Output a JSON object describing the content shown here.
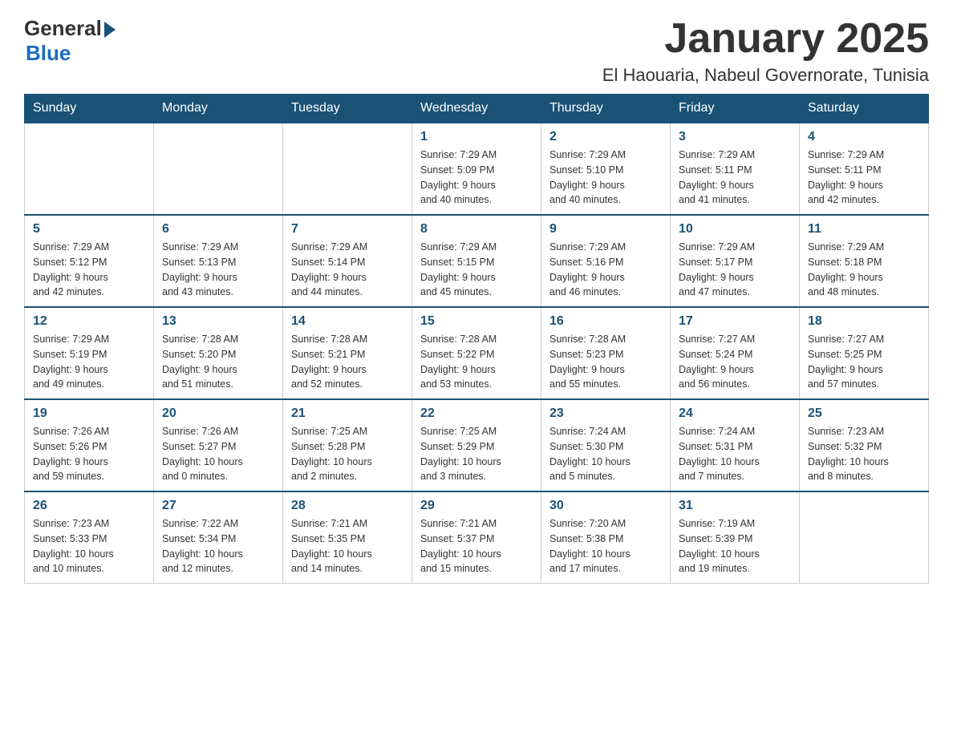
{
  "header": {
    "logo": {
      "general": "General",
      "blue": "Blue"
    },
    "title": "January 2025",
    "location": "El Haouaria, Nabeul Governorate, Tunisia"
  },
  "weekdays": [
    "Sunday",
    "Monday",
    "Tuesday",
    "Wednesday",
    "Thursday",
    "Friday",
    "Saturday"
  ],
  "weeks": [
    [
      {
        "day": "",
        "info": ""
      },
      {
        "day": "",
        "info": ""
      },
      {
        "day": "",
        "info": ""
      },
      {
        "day": "1",
        "info": "Sunrise: 7:29 AM\nSunset: 5:09 PM\nDaylight: 9 hours\nand 40 minutes."
      },
      {
        "day": "2",
        "info": "Sunrise: 7:29 AM\nSunset: 5:10 PM\nDaylight: 9 hours\nand 40 minutes."
      },
      {
        "day": "3",
        "info": "Sunrise: 7:29 AM\nSunset: 5:11 PM\nDaylight: 9 hours\nand 41 minutes."
      },
      {
        "day": "4",
        "info": "Sunrise: 7:29 AM\nSunset: 5:11 PM\nDaylight: 9 hours\nand 42 minutes."
      }
    ],
    [
      {
        "day": "5",
        "info": "Sunrise: 7:29 AM\nSunset: 5:12 PM\nDaylight: 9 hours\nand 42 minutes."
      },
      {
        "day": "6",
        "info": "Sunrise: 7:29 AM\nSunset: 5:13 PM\nDaylight: 9 hours\nand 43 minutes."
      },
      {
        "day": "7",
        "info": "Sunrise: 7:29 AM\nSunset: 5:14 PM\nDaylight: 9 hours\nand 44 minutes."
      },
      {
        "day": "8",
        "info": "Sunrise: 7:29 AM\nSunset: 5:15 PM\nDaylight: 9 hours\nand 45 minutes."
      },
      {
        "day": "9",
        "info": "Sunrise: 7:29 AM\nSunset: 5:16 PM\nDaylight: 9 hours\nand 46 minutes."
      },
      {
        "day": "10",
        "info": "Sunrise: 7:29 AM\nSunset: 5:17 PM\nDaylight: 9 hours\nand 47 minutes."
      },
      {
        "day": "11",
        "info": "Sunrise: 7:29 AM\nSunset: 5:18 PM\nDaylight: 9 hours\nand 48 minutes."
      }
    ],
    [
      {
        "day": "12",
        "info": "Sunrise: 7:29 AM\nSunset: 5:19 PM\nDaylight: 9 hours\nand 49 minutes."
      },
      {
        "day": "13",
        "info": "Sunrise: 7:28 AM\nSunset: 5:20 PM\nDaylight: 9 hours\nand 51 minutes."
      },
      {
        "day": "14",
        "info": "Sunrise: 7:28 AM\nSunset: 5:21 PM\nDaylight: 9 hours\nand 52 minutes."
      },
      {
        "day": "15",
        "info": "Sunrise: 7:28 AM\nSunset: 5:22 PM\nDaylight: 9 hours\nand 53 minutes."
      },
      {
        "day": "16",
        "info": "Sunrise: 7:28 AM\nSunset: 5:23 PM\nDaylight: 9 hours\nand 55 minutes."
      },
      {
        "day": "17",
        "info": "Sunrise: 7:27 AM\nSunset: 5:24 PM\nDaylight: 9 hours\nand 56 minutes."
      },
      {
        "day": "18",
        "info": "Sunrise: 7:27 AM\nSunset: 5:25 PM\nDaylight: 9 hours\nand 57 minutes."
      }
    ],
    [
      {
        "day": "19",
        "info": "Sunrise: 7:26 AM\nSunset: 5:26 PM\nDaylight: 9 hours\nand 59 minutes."
      },
      {
        "day": "20",
        "info": "Sunrise: 7:26 AM\nSunset: 5:27 PM\nDaylight: 10 hours\nand 0 minutes."
      },
      {
        "day": "21",
        "info": "Sunrise: 7:25 AM\nSunset: 5:28 PM\nDaylight: 10 hours\nand 2 minutes."
      },
      {
        "day": "22",
        "info": "Sunrise: 7:25 AM\nSunset: 5:29 PM\nDaylight: 10 hours\nand 3 minutes."
      },
      {
        "day": "23",
        "info": "Sunrise: 7:24 AM\nSunset: 5:30 PM\nDaylight: 10 hours\nand 5 minutes."
      },
      {
        "day": "24",
        "info": "Sunrise: 7:24 AM\nSunset: 5:31 PM\nDaylight: 10 hours\nand 7 minutes."
      },
      {
        "day": "25",
        "info": "Sunrise: 7:23 AM\nSunset: 5:32 PM\nDaylight: 10 hours\nand 8 minutes."
      }
    ],
    [
      {
        "day": "26",
        "info": "Sunrise: 7:23 AM\nSunset: 5:33 PM\nDaylight: 10 hours\nand 10 minutes."
      },
      {
        "day": "27",
        "info": "Sunrise: 7:22 AM\nSunset: 5:34 PM\nDaylight: 10 hours\nand 12 minutes."
      },
      {
        "day": "28",
        "info": "Sunrise: 7:21 AM\nSunset: 5:35 PM\nDaylight: 10 hours\nand 14 minutes."
      },
      {
        "day": "29",
        "info": "Sunrise: 7:21 AM\nSunset: 5:37 PM\nDaylight: 10 hours\nand 15 minutes."
      },
      {
        "day": "30",
        "info": "Sunrise: 7:20 AM\nSunset: 5:38 PM\nDaylight: 10 hours\nand 17 minutes."
      },
      {
        "day": "31",
        "info": "Sunrise: 7:19 AM\nSunset: 5:39 PM\nDaylight: 10 hours\nand 19 minutes."
      },
      {
        "day": "",
        "info": ""
      }
    ]
  ]
}
